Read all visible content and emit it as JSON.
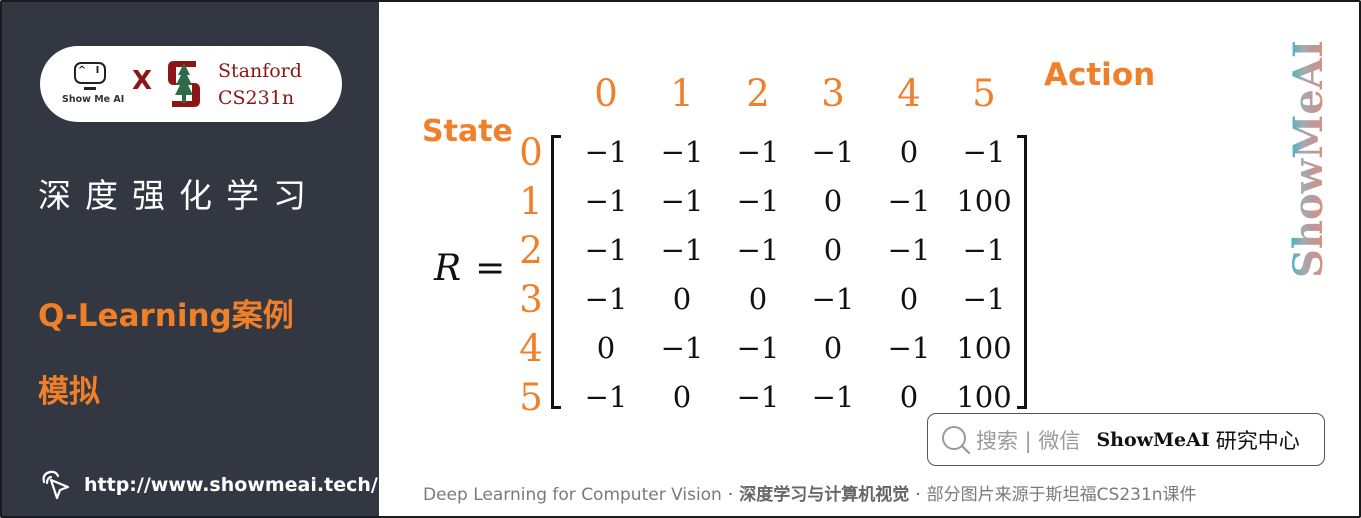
{
  "sidebar": {
    "logo": {
      "showmeai_text": "Show Me AI",
      "showmeai_eyes": "^ I",
      "cross": "X",
      "stanford_line1": "Stanford",
      "stanford_line2": "CS231n"
    },
    "course_title": "深度强化学习",
    "topic_line1": "Q-Learning案例",
    "topic_line2": "模拟",
    "url": "http://www.showmeai.tech/"
  },
  "slide": {
    "state_label": "State",
    "action_label": "Action",
    "matrix_name": "R",
    "equals": "=",
    "column_indices": [
      "0",
      "1",
      "2",
      "3",
      "4",
      "5"
    ],
    "row_indices": [
      "0",
      "1",
      "2",
      "3",
      "4",
      "5"
    ],
    "matrix": [
      [
        "−1",
        "−1",
        "−1",
        "−1",
        "0",
        "−1"
      ],
      [
        "−1",
        "−1",
        "−1",
        "0",
        "−1",
        "100"
      ],
      [
        "−1",
        "−1",
        "−1",
        "0",
        "−1",
        "−1"
      ],
      [
        "−1",
        "0",
        "0",
        "−1",
        "0",
        "−1"
      ],
      [
        "0",
        "−1",
        "−1",
        "0",
        "−1",
        "100"
      ],
      [
        "−1",
        "0",
        "−1",
        "−1",
        "0",
        "100"
      ]
    ],
    "watermark": "ShowMeAI"
  },
  "search_box": {
    "hint": "搜索 | 微信",
    "brand": "ShowMeAI",
    "brand_cn": "研究中心"
  },
  "footer": {
    "part1": "Deep Learning for Computer Vision",
    "separator": "·",
    "part2": "深度学习与计算机视觉",
    "part3": "部分图片来源于斯坦福CS231n课件"
  },
  "colors": {
    "sidebar_bg": "#323741",
    "accent_orange": "#f07f2a",
    "stanford_red": "#8c1515"
  }
}
